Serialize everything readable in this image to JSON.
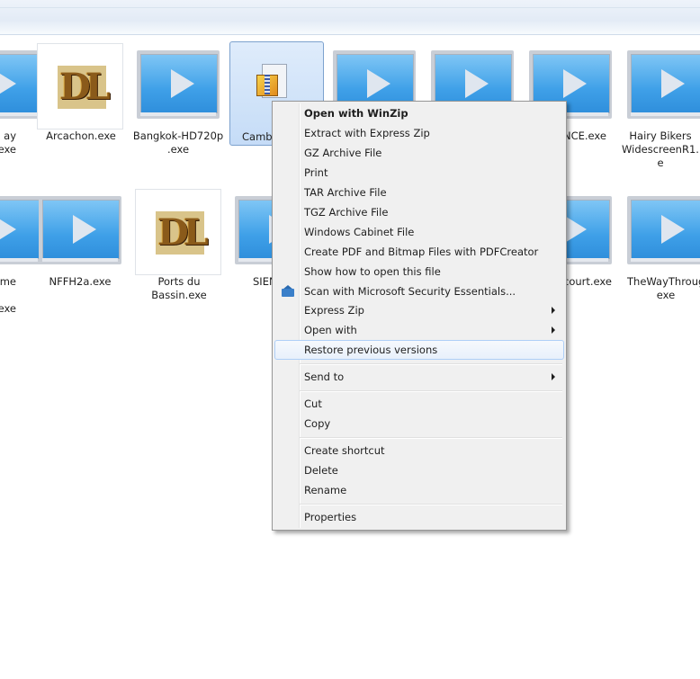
{
  "files": {
    "row1": [
      {
        "label": "ay\ne..exe"
      },
      {
        "label": "Arcachon.exe"
      },
      {
        "label": "Bangkok-HD720p\n.exe"
      },
      {
        "label": "Camb"
      },
      {
        "label": ""
      },
      {
        "label": ""
      },
      {
        "label": "NCE.exe"
      },
      {
        "label": "Hairy Bikers\nWidescreenR1.\ne"
      }
    ],
    "row2": [
      {
        "label": "me\n\n.exe"
      },
      {
        "label": "NFFH2a.exe"
      },
      {
        "label": "Ports du\nBassin.exe"
      },
      {
        "label": "SIEN"
      },
      {
        "label": ""
      },
      {
        "label": ""
      },
      {
        "label": "court.exe"
      },
      {
        "label": "TheWayThroug\nexe"
      }
    ]
  },
  "icons": {
    "video": "video-file-icon",
    "dl": "dl-app-icon",
    "zip": "winzip-archive-icon",
    "security": "security-essentials-icon"
  },
  "context_menu": {
    "items": [
      {
        "label": "Open with WinZip",
        "bold": true
      },
      {
        "label": "Extract with Express Zip"
      },
      {
        "label": "GZ Archive File"
      },
      {
        "label": "Print"
      },
      {
        "label": "TAR Archive File"
      },
      {
        "label": "TGZ Archive File"
      },
      {
        "label": "Windows Cabinet File"
      },
      {
        "label": "Create PDF and Bitmap Files with PDFCreator"
      },
      {
        "label": "Show how to open this file"
      },
      {
        "label": "Scan with Microsoft Security Essentials..."
      },
      {
        "label": "Express Zip",
        "submenu": true
      },
      {
        "label": "Open with",
        "submenu": true
      },
      {
        "label": "Restore previous versions",
        "highlighted": true
      },
      {
        "label": "Send to",
        "submenu": true
      },
      {
        "label": "Cut"
      },
      {
        "label": "Copy"
      },
      {
        "label": "Create shortcut"
      },
      {
        "label": "Delete"
      },
      {
        "label": "Rename"
      },
      {
        "label": "Properties"
      }
    ]
  },
  "colors": {
    "menu_bg": "#f0f0f0",
    "selection": "#c5dcf7",
    "hover_border": "#aecff7"
  }
}
